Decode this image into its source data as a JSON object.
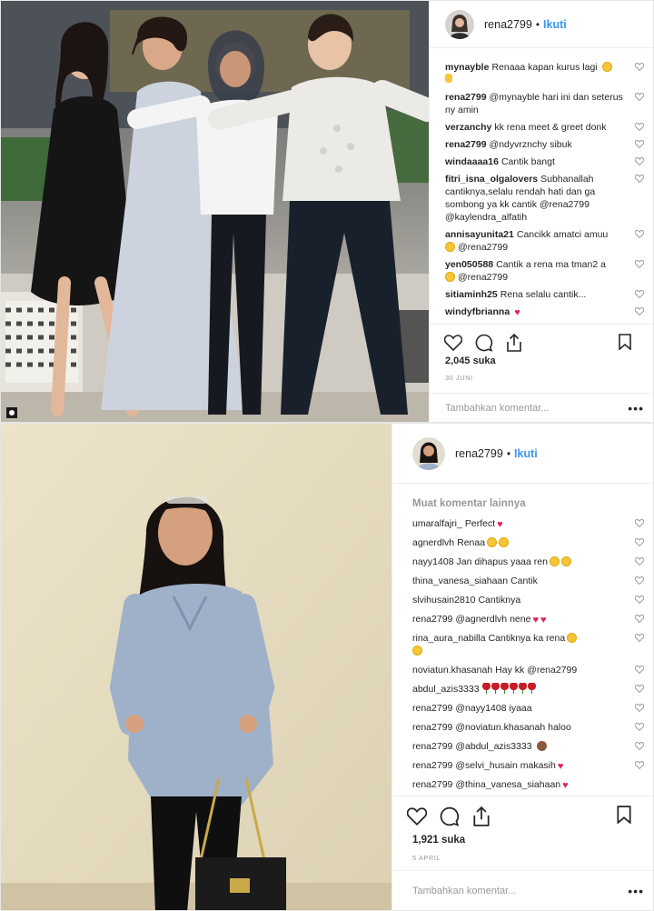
{
  "post1": {
    "username": "rena2799",
    "separator": "•",
    "follow_label": "Ikuti",
    "comments": [
      {
        "user": "mynayble",
        "text": "Renaaa kapan kurus lagi",
        "emoji": "smile"
      },
      {
        "user": "rena2799",
        "text": "@mynayble hari ini dan seterus ny amin"
      },
      {
        "user": "verzanchy",
        "text": "kk rena meet & greet donk"
      },
      {
        "user": "rena2799",
        "text": "@ndyvrznchy sibuk"
      },
      {
        "user": "windaaaa16",
        "text": "Cantik bangt"
      },
      {
        "user": "fitri_isna_olgalovers",
        "text": "Subhanallah cantiknya,selalu rendah hati dan ga sombong ya kk cantik @rena2799 @kaylendra_alfatih"
      },
      {
        "user": "annisayunita21",
        "text": "Cancikk amatci amuu",
        "emoji_prefix": "heart-eyes",
        "text2": "@rena2799"
      },
      {
        "user": "yen050588",
        "text": "Cantik a rena ma tman2 a",
        "emoji_prefix": "heart-eyes",
        "text2": "@rena2799"
      },
      {
        "user": "sitiaminh25",
        "text": "Rena selalu cantik..."
      },
      {
        "user": "windyfbrianna",
        "text": "",
        "emoji": "heart"
      }
    ],
    "likes": "2,045 suka",
    "date": "30 JUNI",
    "add_comment_placeholder": "Tambahkan komentar...",
    "more_label": "•••"
  },
  "post2": {
    "username": "rena2799",
    "separator": "•",
    "follow_label": "Ikuti",
    "load_more": "Muat komentar lainnya",
    "comments": [
      {
        "user": "umaralfajri_",
        "text": "Perfect",
        "emoji": "heart"
      },
      {
        "user": "agnerdlvh",
        "text": "Renaa",
        "emoji": "heart-eyes2"
      },
      {
        "user": "nayy1408",
        "text": "Jan dihapus yaaa ren",
        "emoji": "heart-eyes-cry"
      },
      {
        "user": "thina_vanesa_siahaan",
        "text": "Cantik"
      },
      {
        "user": "slvihusain2810",
        "text": "Cantiknya"
      },
      {
        "user": "rena2799",
        "text": "@agnerdlvh nene",
        "emoji": "hearts2"
      },
      {
        "user": "rina_aura_nabilla",
        "text": "Cantiknya ka rena",
        "emoji": "heart-eyes-wrap"
      },
      {
        "user": "noviatun.khasanah",
        "text": "Hay kk @rena2799"
      },
      {
        "user": "abdul_azis3333",
        "text": "",
        "emoji": "roses"
      },
      {
        "user": "rena2799",
        "text": "@nayy1408 iyaaa"
      },
      {
        "user": "rena2799",
        "text": "@noviatun.khasanah haloo"
      },
      {
        "user": "rena2799",
        "text": "@abdul_azis3333",
        "emoji": "monkey"
      },
      {
        "user": "rena2799",
        "text": "@selvi_husain makasih",
        "emoji": "heart"
      },
      {
        "user": "rena2799",
        "text": "@thina_vanesa_siahaan",
        "emoji": "heart"
      }
    ],
    "likes": "1,921 suka",
    "date": "5 APRIL",
    "add_comment_placeholder": "Tambahkan komentar...",
    "more_label": "•••"
  },
  "colors": {
    "accent": "#3897f0",
    "heart": "#e0245e"
  }
}
